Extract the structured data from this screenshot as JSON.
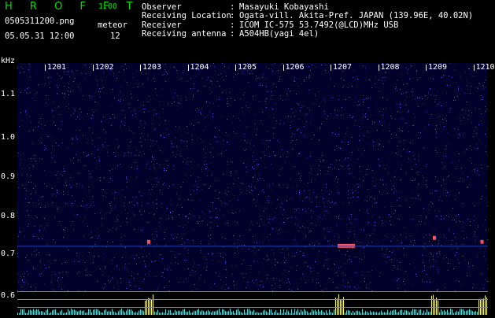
{
  "header": {
    "brand": "H R O F F T",
    "version": "1.00",
    "filename": "0505311200.png",
    "meteor_label": "meteor",
    "meteor_count": "12",
    "datetime": "05.05.31 12:00"
  },
  "info": [
    {
      "key": "Observer",
      "value": "Masayuki Kobayashi"
    },
    {
      "key": "Receiving Location",
      "value": "Ogata-vill. Akita-Pref. JAPAN (139.96E, 40.02N)"
    },
    {
      "key": "Receiver",
      "value": "ICOM IC-575 53.7492(@LCD)MHz USB"
    },
    {
      "key": "Receiving antenna",
      "value": "A504HB(yagi 4el)"
    }
  ],
  "axis": {
    "unit": "kHz",
    "y_ticks": [
      "1.1",
      "1.0",
      "0.9",
      "0.8",
      "0.7",
      "0.6"
    ],
    "x_ticks": [
      "1201",
      "1202",
      "1203",
      "1204",
      "1205",
      "1206",
      "1207",
      "1208",
      "1209",
      "1210"
    ]
  },
  "chart_data": {
    "type": "heatmap",
    "title": "",
    "xlabel": "",
    "ylabel": "kHz",
    "x_ticks": [
      "1201",
      "1202",
      "1203",
      "1204",
      "1205",
      "1206",
      "1207",
      "1208",
      "1209",
      "1210"
    ],
    "y_ticks": [
      1.1,
      1.0,
      0.9,
      0.8,
      0.7,
      0.6
    ],
    "meteor_count": 12,
    "echoes": [
      {
        "time": "1203",
        "freq_khz": 0.73
      },
      {
        "time": "1207",
        "freq_khz": 0.72
      },
      {
        "time": "1209",
        "freq_khz": 0.74
      },
      {
        "time": "1210",
        "freq_khz": 0.73
      }
    ]
  }
}
